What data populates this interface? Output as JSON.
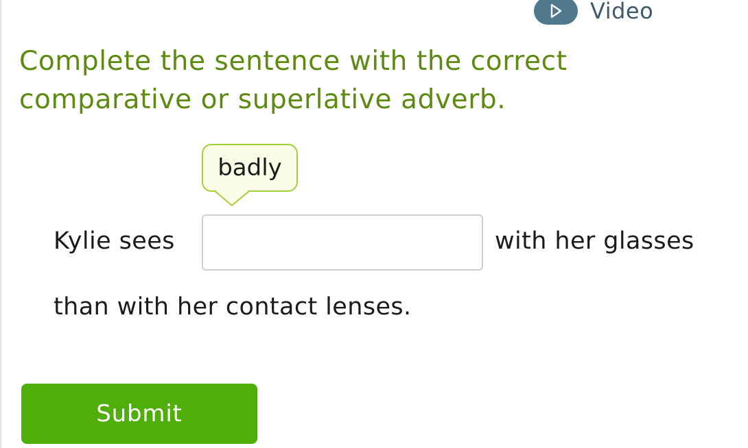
{
  "header": {
    "video_label": "Video",
    "video_icon": "play-icon"
  },
  "question": {
    "instruction": "Complete the sentence with the correct comparative or superlative adverb.",
    "hint_word": "badly",
    "sentence_before": "Kylie sees",
    "sentence_after": "with her glasses",
    "sentence_end": "than with her contact lenses.",
    "answer_value": ""
  },
  "actions": {
    "submit_label": "Submit"
  },
  "colors": {
    "instruction_text": "#5e8a12",
    "video_badge": "#50798e",
    "hint_background": "#fbfde6",
    "hint_border": "#a4cf3a",
    "submit_background": "#4fae0a"
  }
}
